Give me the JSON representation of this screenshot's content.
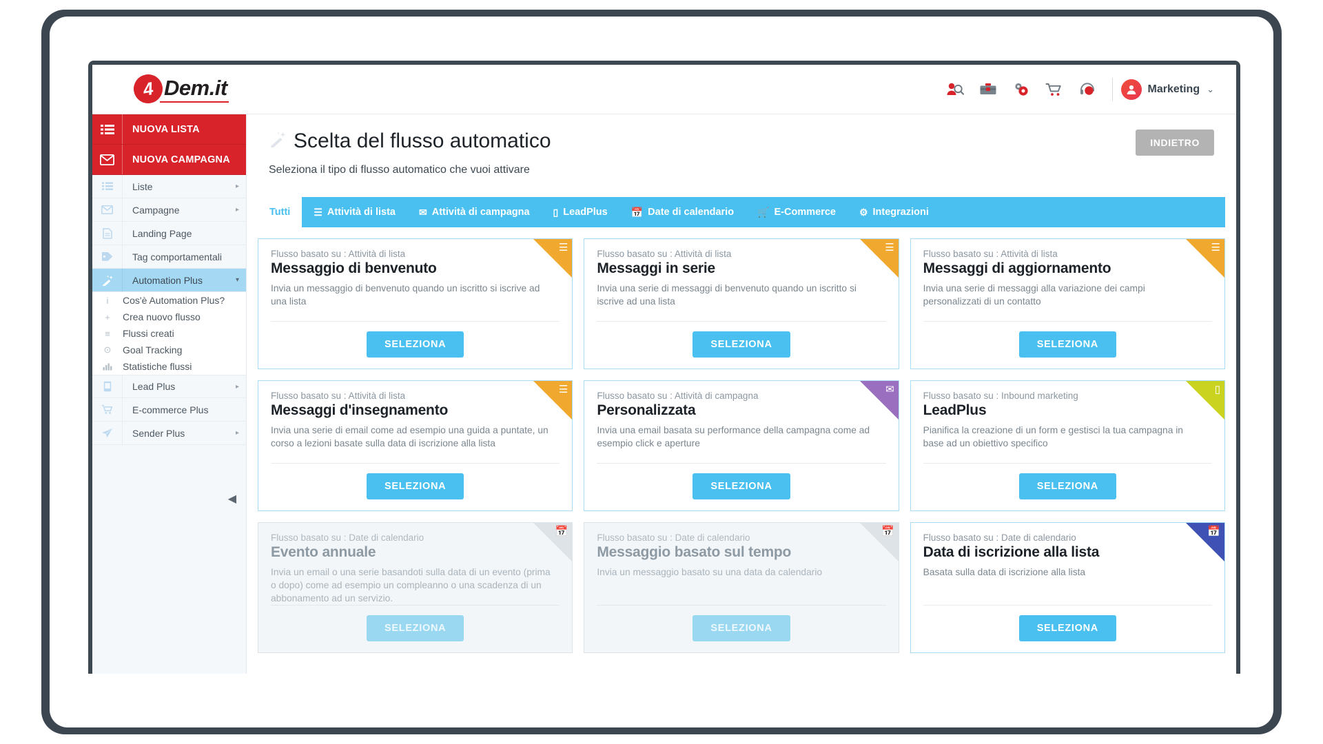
{
  "brand": {
    "mark": "4",
    "word": "Dem.it"
  },
  "topbar": {
    "icons": [
      {
        "name": "user-search-icon",
        "glyph": "👤🔍"
      },
      {
        "name": "toolbox-icon",
        "glyph": "🧰"
      },
      {
        "name": "gear-settings-icon",
        "glyph": "⚙"
      },
      {
        "name": "cart-icon",
        "glyph": "🛒"
      },
      {
        "name": "support-headset-icon",
        "glyph": "🎧"
      }
    ],
    "user": {
      "name": "Marketing",
      "caret": "⌄"
    }
  },
  "sidebar": {
    "primary": [
      {
        "label": "NUOVA LISTA",
        "icon": "list-icon"
      },
      {
        "label": "NUOVA CAMPAGNA",
        "icon": "envelope-icon"
      }
    ],
    "items": [
      {
        "label": "Liste",
        "icon": "list-icon",
        "arrow": "▸",
        "active": false
      },
      {
        "label": "Campagne",
        "icon": "envelope-icon",
        "arrow": "▸",
        "active": false
      },
      {
        "label": "Landing Page",
        "icon": "page-icon",
        "arrow": "",
        "active": false
      },
      {
        "label": "Tag comportamentali",
        "icon": "tag-icon",
        "arrow": "",
        "active": false
      },
      {
        "label": "Automation Plus",
        "icon": "magic-wand-icon",
        "arrow": "▾",
        "active": true
      }
    ],
    "subitems": [
      {
        "label": "Cos'è Automation Plus?",
        "icon": "info-icon",
        "glyph": "i"
      },
      {
        "label": "Crea nuovo flusso",
        "icon": "plus-icon",
        "glyph": "+"
      },
      {
        "label": "Flussi creati",
        "icon": "lines-icon",
        "glyph": "≡"
      },
      {
        "label": "Goal Tracking",
        "icon": "target-icon",
        "glyph": "⊙"
      },
      {
        "label": "Statistiche flussi",
        "icon": "bar-chart-icon",
        "glyph": "▐"
      }
    ],
    "items_after": [
      {
        "label": "Lead Plus",
        "icon": "mobile-icon",
        "arrow": "▸",
        "active": false
      },
      {
        "label": "E-commerce Plus",
        "icon": "cart-icon",
        "arrow": "",
        "active": false
      },
      {
        "label": "Sender Plus",
        "icon": "paper-plane-icon",
        "arrow": "▸",
        "active": false
      }
    ],
    "collapse": {
      "name": "collapse-sidebar-arrow",
      "glyph": "◀"
    }
  },
  "page": {
    "title": "Scelta del flusso automatico",
    "title_icon": "magic-wand-icon",
    "subtitle": "Seleziona il tipo di flusso automatico che vuoi attivare",
    "back_label": "INDIETRO"
  },
  "tabs": [
    {
      "label": "Tutti",
      "icon": "",
      "glyph": "",
      "active": true
    },
    {
      "label": "Attività di lista",
      "icon": "list-icon",
      "glyph": "☰",
      "active": false
    },
    {
      "label": "Attività di campagna",
      "icon": "envelope-icon",
      "glyph": "✉",
      "active": false
    },
    {
      "label": "LeadPlus",
      "icon": "mobile-icon",
      "glyph": "▯",
      "active": false
    },
    {
      "label": "Date di calendario",
      "icon": "calendar-icon",
      "glyph": "📅",
      "active": false
    },
    {
      "label": "E-Commerce",
      "icon": "cart-icon",
      "glyph": "🛒",
      "active": false
    },
    {
      "label": "Integrazioni",
      "icon": "gears-icon",
      "glyph": "⚙",
      "active": false
    }
  ],
  "cards": [
    {
      "source_label": "Flusso basato su : Attività di lista",
      "title": "Messaggio di benvenuto",
      "description": "Invia un messaggio di benvenuto quando un iscritto si iscrive ad una lista",
      "button": "SELEZIONA",
      "ribbon_color": "#f0a92e",
      "ribbon_icon": "list-icon",
      "ribbon_glyph": "☰",
      "disabled": false
    },
    {
      "source_label": "Flusso basato su : Attività di lista",
      "title": "Messaggi in serie",
      "description": "Invia una serie di messaggi di benvenuto quando un iscritto si iscrive ad una lista",
      "button": "SELEZIONA",
      "ribbon_color": "#f0a92e",
      "ribbon_icon": "list-icon",
      "ribbon_glyph": "☰",
      "disabled": false
    },
    {
      "source_label": "Flusso basato su : Attività di lista",
      "title": "Messaggi di aggiornamento",
      "description": "Invia una serie di messaggi alla variazione dei campi personalizzati di un contatto",
      "button": "SELEZIONA",
      "ribbon_color": "#f0a92e",
      "ribbon_icon": "list-icon",
      "ribbon_glyph": "☰",
      "disabled": false
    },
    {
      "source_label": "Flusso basato su : Attività di lista",
      "title": "Messaggi d'insegnamento",
      "description": "Invia una serie di email come ad esempio una guida a puntate, un corso a lezioni basate sulla data di iscrizione alla lista",
      "button": "SELEZIONA",
      "ribbon_color": "#f0a92e",
      "ribbon_icon": "list-icon",
      "ribbon_glyph": "☰",
      "disabled": false
    },
    {
      "source_label": "Flusso basato su : Attività di campagna",
      "title": "Personalizzata",
      "description": "Invia una email basata su performance della campagna come ad esempio click e aperture",
      "button": "SELEZIONA",
      "ribbon_color": "#9b6fc0",
      "ribbon_icon": "envelope-icon",
      "ribbon_glyph": "✉",
      "disabled": false
    },
    {
      "source_label": "Flusso basato su : Inbound marketing",
      "title": "LeadPlus",
      "description": "Pianifica la creazione di un form e gestisci la tua campagna in base ad un obiettivo specifico",
      "button": "SELEZIONA",
      "ribbon_color": "#cbd321",
      "ribbon_icon": "mobile-icon",
      "ribbon_glyph": "▯",
      "disabled": false
    },
    {
      "source_label": "Flusso basato su : Date di calendario",
      "title": "Evento annuale",
      "description": "Invia un email o una serie basandoti sulla data di un evento (prima o dopo) come ad esempio un compleanno o una scadenza di un abbonamento ad un servizio.",
      "button": "SELEZIONA",
      "ribbon_color": "#dde3e7",
      "ribbon_icon": "calendar-icon",
      "ribbon_glyph": "📅",
      "disabled": true
    },
    {
      "source_label": "Flusso basato su : Date di calendario",
      "title": "Messaggio basato sul tempo",
      "description": "Invia un messaggio basato su una data da calendario",
      "button": "SELEZIONA",
      "ribbon_color": "#dde3e7",
      "ribbon_icon": "calendar-icon",
      "ribbon_glyph": "📅",
      "disabled": true
    },
    {
      "source_label": "Flusso basato su : Date di calendario",
      "title": "Data di iscrizione alla lista",
      "description": "Basata sulla data di iscrizione alla lista",
      "button": "SELEZIONA",
      "ribbon_color": "#3f51b5",
      "ribbon_icon": "calendar-icon",
      "ribbon_glyph": "📅",
      "disabled": false
    }
  ],
  "colors": {
    "brand_red": "#d8232a",
    "accent_blue": "#49c0ef",
    "sidebar_active": "#a5d8f3",
    "back_gray": "#b3b3b3"
  }
}
